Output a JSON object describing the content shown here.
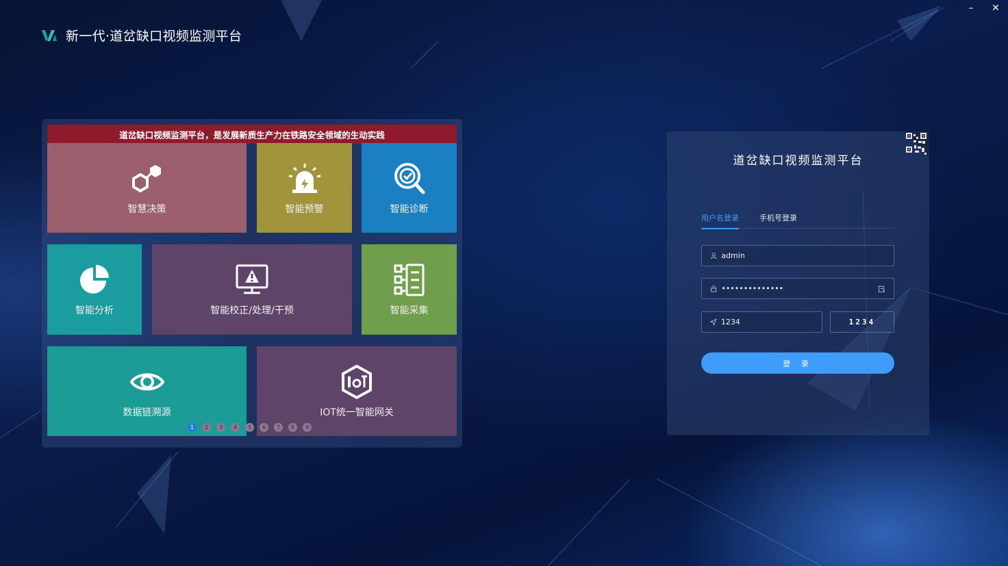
{
  "window": {
    "minimize_label": "–",
    "close_label": "✕"
  },
  "header": {
    "title": "新一代·道岔缺口视频监测平台"
  },
  "banner": {
    "text": "道岔缺口视频监测平台，是发展新质生产力在铁路安全领域的生动实践"
  },
  "tiles": [
    {
      "label": "智慧决策",
      "icon": "hexagon-nodes-icon",
      "color": "#9c5f6e"
    },
    {
      "label": "智能预警",
      "icon": "alarm-siren-icon",
      "color": "#a1953c"
    },
    {
      "label": "智能诊断",
      "icon": "magnifier-check-icon",
      "color": "#1a80c2"
    },
    {
      "label": "智能分析",
      "icon": "pie-chart-icon",
      "color": "#1b9c9f"
    },
    {
      "label": "智能校正/处理/干预",
      "icon": "monitor-warning-icon",
      "color": "#5e4468"
    },
    {
      "label": "智能采集",
      "icon": "data-collect-icon",
      "color": "#6f9f4c"
    },
    {
      "label": "数据链溯源",
      "icon": "eye-icon",
      "color": "#1c9c96"
    },
    {
      "label": "IOT统一智能网关",
      "icon": "iot-gateway-icon",
      "color": "#5f4469"
    }
  ],
  "pager": {
    "pages": [
      "1",
      "2",
      "3",
      "4",
      "5",
      "6",
      "7",
      "8",
      "9"
    ],
    "active": "1"
  },
  "login": {
    "title": "道岔缺口视频监测平台",
    "tabs": [
      "用户名登录",
      "手机号登录"
    ],
    "active_tab": "用户名登录",
    "username": "admin",
    "password": "••••••••••••••",
    "captcha_input": "1234",
    "captcha_image_text": "1234",
    "submit_label": "登 录",
    "accent": "#3f9cf9"
  }
}
